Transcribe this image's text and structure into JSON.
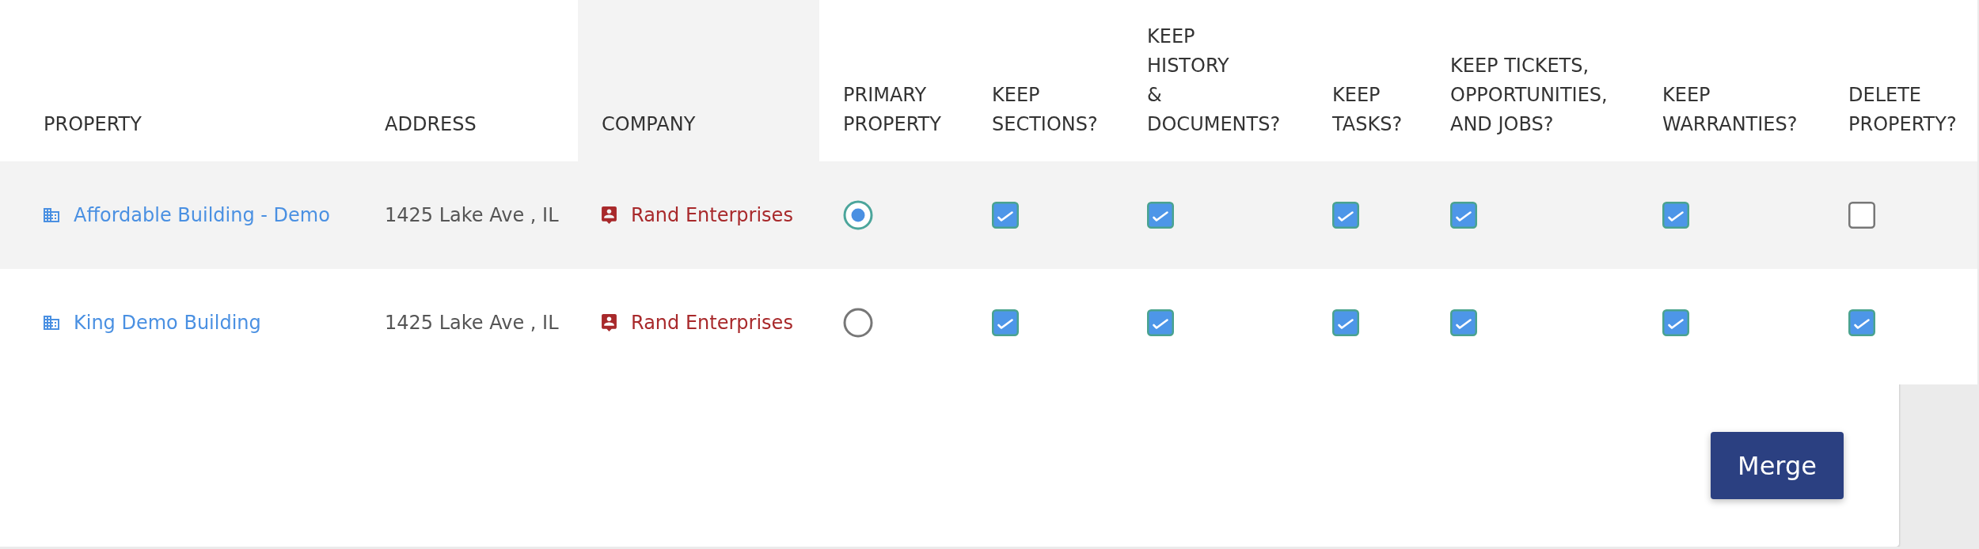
{
  "table": {
    "columns": [
      {
        "label": "PROPERTY",
        "kind": "property",
        "highlighted": false
      },
      {
        "label": "ADDRESS",
        "kind": "text",
        "highlighted": false
      },
      {
        "label": "COMPANY",
        "kind": "company",
        "highlighted": true
      },
      {
        "label": "PRIMARY\nPROPERTY",
        "kind": "radio",
        "highlighted": false
      },
      {
        "label": "KEEP\nSECTIONS?",
        "kind": "checkbox",
        "highlighted": false
      },
      {
        "label": "KEEP\nHISTORY\n&\nDOCUMENTS?",
        "kind": "checkbox",
        "highlighted": false
      },
      {
        "label": "KEEP\nTASKS?",
        "kind": "checkbox",
        "highlighted": false
      },
      {
        "label": "KEEP TICKETS,\nOPPORTUNITIES,\nAND JOBS?",
        "kind": "checkbox",
        "highlighted": false
      },
      {
        "label": "KEEP\nWARRANTIES?",
        "kind": "checkbox",
        "highlighted": false
      },
      {
        "label": "DELETE\nPROPERTY?",
        "kind": "checkbox",
        "highlighted": false
      }
    ],
    "rows": [
      {
        "highlighted": true,
        "cells": [
          {
            "text": "Affordable Building - Demo"
          },
          {
            "text": "1425 Lake Ave , IL"
          },
          {
            "text": "Rand Enterprises"
          },
          {
            "selected": true
          },
          {
            "checked": true
          },
          {
            "checked": true
          },
          {
            "checked": true
          },
          {
            "checked": true
          },
          {
            "checked": true
          },
          {
            "checked": false
          }
        ]
      },
      {
        "highlighted": false,
        "cells": [
          {
            "text": "King Demo Building"
          },
          {
            "text": "1425 Lake Ave , IL"
          },
          {
            "text": "Rand Enterprises"
          },
          {
            "selected": false
          },
          {
            "checked": true
          },
          {
            "checked": true
          },
          {
            "checked": true
          },
          {
            "checked": true
          },
          {
            "checked": true
          },
          {
            "checked": true
          }
        ]
      }
    ]
  },
  "merge_button": {
    "label": "Merge"
  }
}
